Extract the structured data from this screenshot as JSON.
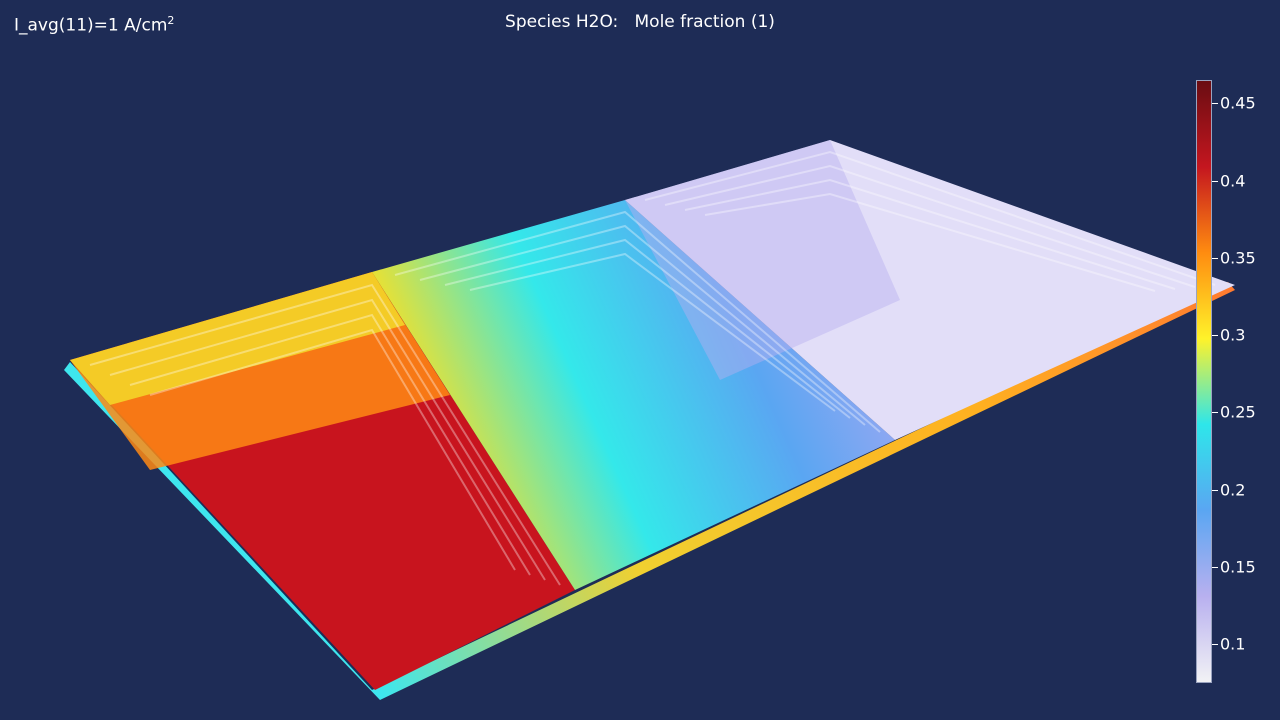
{
  "header": {
    "param_prefix": "I_avg(11)=1 A/cm",
    "param_exponent": "2",
    "title": "Species H2O:   Mole fraction (1)"
  },
  "colorbar": {
    "min": 0.075,
    "max": 0.465,
    "ticks": [
      {
        "value": 0.45,
        "label": "0.45"
      },
      {
        "value": 0.4,
        "label": "0.4"
      },
      {
        "value": 0.35,
        "label": "0.35"
      },
      {
        "value": 0.3,
        "label": "0.3"
      },
      {
        "value": 0.25,
        "label": "0.25"
      },
      {
        "value": 0.2,
        "label": "0.2"
      },
      {
        "value": 0.15,
        "label": "0.15"
      },
      {
        "value": 0.1,
        "label": "0.1"
      }
    ],
    "colors": [
      "#f2f2f5",
      "#b8b0ef",
      "#5aa6f2",
      "#2ee6ea",
      "#fff22a",
      "#ff8c10",
      "#c4161f",
      "#6a0d12"
    ]
  },
  "colors": {
    "background": "#1e2c56",
    "outlet_section": "#c8141e",
    "middle_section": "#40d8ee",
    "inlet_section": "#e6e2fa"
  }
}
